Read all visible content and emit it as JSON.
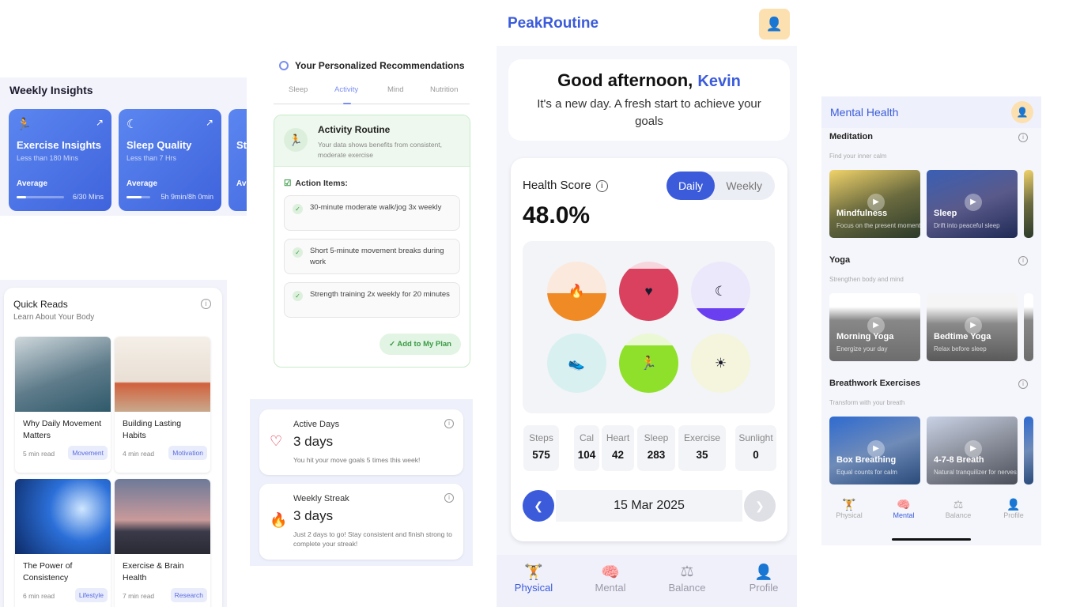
{
  "weekly": {
    "title": "Weekly Insights",
    "cards": [
      {
        "name": "Exercise Insights",
        "sub": "Less than 180 Mins",
        "level": "Average",
        "value": "6/30 Mins",
        "progress": 0.2
      },
      {
        "name": "Sleep Quality",
        "sub": "Less than 7 Hrs",
        "level": "Average",
        "value": "5h 9min/8h 0min",
        "progress": 0.64
      },
      {
        "name": "St",
        "sub": "",
        "level": "Av",
        "value": "",
        "progress": 0
      }
    ]
  },
  "quick_reads": {
    "title": "Quick Reads",
    "subtitle": "Learn About Your Body",
    "info_icon": "info-icon",
    "cards": [
      {
        "title": "Why Daily Movement Matters",
        "meta": "5 min read",
        "tag": "Movement"
      },
      {
        "title": "Building Lasting Habits",
        "meta": "4 min read",
        "tag": "Motivation"
      },
      {
        "title": "The Power of Consistency",
        "meta": "6 min read",
        "tag": "Lifestyle"
      },
      {
        "title": "Exercise & Brain Health",
        "meta": "7 min read",
        "tag": "Research"
      }
    ]
  },
  "recommendations": {
    "title": "Your Personalized Recommendations",
    "tabs": [
      "Sleep",
      "Activity",
      "Mind",
      "Nutrition"
    ],
    "active_tab": "Activity",
    "routine_title": "Activity Routine",
    "routine_desc": "Your data shows benefits from consistent, moderate exercise",
    "action_label": "Action Items:",
    "actions": [
      "30-minute moderate walk/jog 3x weekly",
      "Short 5-minute movement breaks during work",
      "Strength training 2x weekly for 20 minutes"
    ],
    "add_button": "Add to My Plan"
  },
  "stats": [
    {
      "label": "Active Days",
      "value": "3 days",
      "desc": "You hit your move goals 5 times this week!"
    },
    {
      "label": "Weekly Streak",
      "value": "3 days",
      "desc": "Just 2 days to go! Stay consistent and finish strong to complete your streak!"
    }
  ],
  "app": {
    "logo": "PeakRoutine",
    "greeting": "Good afternoon,",
    "user": "Kevin",
    "tagline": "It's a new day. A fresh start to achieve your goals",
    "health_score_label": "Health Score",
    "toggle": [
      "Daily",
      "Weekly"
    ],
    "score": "48.0%",
    "circles": [
      {
        "icon": "flame-icon",
        "glyph": "🔥",
        "bg": "#fbe9dd",
        "fill": "#f08a24",
        "level": 0.47
      },
      {
        "icon": "heart-icon",
        "glyph": "♥",
        "bg": "#f7d7de",
        "fill": "#d9415f",
        "level": 0.88
      },
      {
        "icon": "moon-icon",
        "glyph": "☾",
        "bg": "#ece8fb",
        "fill": "#6a3ff0",
        "level": 0.22
      },
      {
        "icon": "shoe-icon",
        "glyph": "👟",
        "bg": "#d9f0f1",
        "fill": "#39b8c2",
        "level": 0
      },
      {
        "icon": "run-icon",
        "glyph": "🏃",
        "bg": "#eaf8d3",
        "fill": "#8fe02a",
        "level": 0.8
      },
      {
        "icon": "sun-icon",
        "glyph": "☀",
        "bg": "#f4f5dc",
        "fill": "#e7e96f",
        "level": 0
      }
    ],
    "metrics": [
      {
        "label": "Steps",
        "value": "575"
      },
      {
        "label": "Cal",
        "value": "104"
      },
      {
        "label": "Heart",
        "value": "42"
      },
      {
        "label": "Sleep",
        "value": "283"
      },
      {
        "label": "Exercise",
        "value": "35"
      },
      {
        "label": "Sunlight",
        "value": "0"
      }
    ],
    "date": "15 Mar 2025",
    "tabbar": [
      {
        "label": "Physical",
        "icon": "dumbbell-icon"
      },
      {
        "label": "Mental",
        "icon": "brain-icon"
      },
      {
        "label": "Balance",
        "icon": "scale-icon"
      },
      {
        "label": "Profile",
        "icon": "person-icon"
      }
    ],
    "active_tab": "Physical"
  },
  "mental": {
    "title": "Mental Health",
    "sections": [
      {
        "title": "Meditation",
        "subtitle": "Find your inner calm",
        "videos": [
          {
            "title": "Mindfulness",
            "sub": "Focus on the present moment"
          },
          {
            "title": "Sleep",
            "sub": "Drift into peaceful sleep"
          }
        ]
      },
      {
        "title": "Yoga",
        "subtitle": "Strengthen body and mind",
        "videos": [
          {
            "title": "Morning Yoga",
            "sub": "Energize your day"
          },
          {
            "title": "Bedtime Yoga",
            "sub": "Relax before sleep"
          }
        ]
      },
      {
        "title": "Breathwork Exercises",
        "subtitle": "Transform with your breath",
        "videos": [
          {
            "title": "Box Breathing",
            "sub": "Equal counts for calm"
          },
          {
            "title": "4-7-8 Breath",
            "sub": "Natural tranquilizer for nerves"
          }
        ]
      }
    ],
    "tabbar": [
      "Physical",
      "Mental",
      "Balance",
      "Profile"
    ],
    "active_tab": "Mental"
  }
}
